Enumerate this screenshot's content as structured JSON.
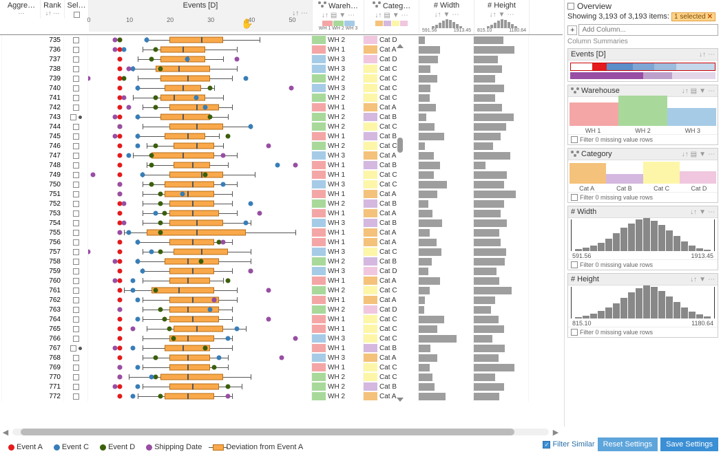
{
  "columns": {
    "aggre": "Aggre…",
    "rank": "Rank",
    "sel": "Sel…",
    "events": "Events [D]",
    "wareh": "Wareh…",
    "categ": "Categ…",
    "width": "Width",
    "height": "Height"
  },
  "axis_ticks": [
    0,
    10,
    20,
    30,
    40,
    50
  ],
  "wh_labels": [
    "WH 1",
    "WH 2",
    "WH 3"
  ],
  "cat_colors": [
    "catA",
    "catB",
    "catC",
    "catD"
  ],
  "width_range": [
    "591.56",
    "1913.45"
  ],
  "height_range": [
    "815.10",
    "1180.64"
  ],
  "legend": {
    "a": "Event A",
    "c": "Event C",
    "d": "Event D",
    "s": "Shipping Date",
    "dev": "Deviation from Event A"
  },
  "side": {
    "overview": "Overview",
    "showing": "Showing 3,193 of 3,193 items:",
    "selected": "1 selected",
    "addcol": "Add Column...",
    "cs": "Column Summaries",
    "events": "Events [D]",
    "warehouse": "Warehouse",
    "category": "Category",
    "width": "Width",
    "height": "Height",
    "filter_missing": "Filter 0 missing value rows",
    "wh_bars": [
      34,
      44,
      26
    ],
    "cat_bars": [
      30,
      14,
      32,
      18
    ],
    "cat_labels": [
      "Cat A",
      "Cat B",
      "Cat C",
      "Cat D"
    ],
    "width_hist": [
      3,
      5,
      8,
      12,
      18,
      26,
      34,
      40,
      46,
      48,
      44,
      38,
      30,
      22,
      14,
      8,
      4,
      2
    ],
    "height_hist": [
      2,
      4,
      7,
      11,
      16,
      22,
      30,
      38,
      44,
      48,
      46,
      40,
      32,
      24,
      16,
      10,
      6,
      3
    ]
  },
  "footer": {
    "filter_similar": "Filter Similar",
    "reset": "Reset Settings",
    "save": "Save Settings"
  },
  "rows": [
    {
      "rank": 735,
      "wh": 2,
      "cat": "D",
      "w": 0.12,
      "h": 0.55,
      "dA": 2,
      "dC": 13,
      "dD": 4,
      "dS": 6,
      "wl": 13,
      "wr": 38,
      "bl": 18,
      "br": 30,
      "med": 25
    },
    {
      "rank": 736,
      "wh": 1,
      "cat": "A",
      "w": 0.4,
      "h": 0.75,
      "dA": 2,
      "dC": 8,
      "dD": 12,
      "dS": 6,
      "wl": 12,
      "wr": 33,
      "bl": 16,
      "br": 26,
      "med": 21
    },
    {
      "rank": 737,
      "wh": 3,
      "cat": "D",
      "w": 0.36,
      "h": 0.45,
      "dA": 2,
      "dC": 22,
      "dD": 11,
      "dS": 33,
      "wl": 11,
      "wr": 30,
      "bl": 16,
      "br": 26,
      "med": 22
    },
    {
      "rank": 738,
      "wh": 3,
      "cat": "C",
      "w": 0.22,
      "h": 0.52,
      "dA": 2,
      "dC": 10,
      "dD": 13,
      "dS": 9,
      "wl": 10,
      "wr": 33,
      "bl": 15,
      "br": 27,
      "med": 20
    },
    {
      "rank": 739,
      "wh": 2,
      "cat": "C",
      "w": 0.34,
      "h": 0.4,
      "dA": 2,
      "dC": 35,
      "dD": 5,
      "dS": 0,
      "wl": 11,
      "wr": 32,
      "bl": 16,
      "br": 27,
      "med": 22
    },
    {
      "rank": 740,
      "wh": 3,
      "cat": "C",
      "w": 0.22,
      "h": 0.56,
      "dA": 2,
      "dC": 11,
      "dD": 24,
      "dS": 45,
      "wl": 11,
      "wr": 28,
      "bl": 17,
      "br": 25,
      "med": 21
    },
    {
      "rank": 741,
      "wh": 2,
      "cat": "C",
      "w": 0.2,
      "h": 0.4,
      "dA": 2,
      "dC": 24,
      "dD": 12,
      "dS": 8,
      "wl": 10,
      "wr": 30,
      "bl": 16,
      "br": 26,
      "med": 19
    },
    {
      "rank": 742,
      "wh": 1,
      "cat": "A",
      "w": 0.32,
      "h": 0.52,
      "dA": 2,
      "dC": 26,
      "dD": 12,
      "dS": 9,
      "wl": 12,
      "wr": 32,
      "bl": 18,
      "br": 29,
      "med": 24
    },
    {
      "rank": 743,
      "wh": 2,
      "cat": "B",
      "w": 0.14,
      "h": 0.74,
      "dA": 2,
      "dC": 11,
      "dD": 24,
      "dS": 6,
      "wl": 11,
      "wr": 31,
      "bl": 16,
      "br": 27,
      "med": 21,
      "selDot": true
    },
    {
      "rank": 744,
      "wh": 2,
      "cat": "C",
      "w": 0.3,
      "h": 0.6,
      "dA": 2,
      "dC": 36,
      "dD": 4,
      "dS": 7,
      "wl": 12,
      "wr": 36,
      "bl": 18,
      "br": 30,
      "med": 24
    },
    {
      "rank": 745,
      "wh": 1,
      "cat": "B",
      "w": 0.48,
      "h": 0.5,
      "dA": 2,
      "dC": 11,
      "dD": 28,
      "dS": 6,
      "wl": 11,
      "wr": 29,
      "bl": 17,
      "br": 26,
      "med": 22
    },
    {
      "rank": 746,
      "wh": 2,
      "cat": "C",
      "w": 0.12,
      "h": 0.36,
      "dA": 2,
      "dC": 11,
      "dD": 12,
      "dS": 40,
      "wl": 13,
      "wr": 30,
      "bl": 19,
      "br": 28,
      "med": 24
    },
    {
      "rank": 747,
      "wh": 3,
      "cat": "A",
      "w": 0.28,
      "h": 0.68,
      "dA": 2,
      "dC": 9,
      "dD": 11,
      "dS": 30,
      "wl": 10,
      "wr": 33,
      "bl": 14,
      "br": 28,
      "med": 21
    },
    {
      "rank": 748,
      "wh": 1,
      "cat": "B",
      "w": 0.4,
      "h": 0.22,
      "dA": 2,
      "dC": 42,
      "dD": 11,
      "dS": 46,
      "wl": 13,
      "wr": 31,
      "bl": 19,
      "br": 27,
      "med": 23
    },
    {
      "rank": 749,
      "wh": 1,
      "cat": "C",
      "w": 0.28,
      "h": 0.62,
      "dA": 2,
      "dC": 12,
      "dD": 23,
      "dS": 1,
      "wl": 12,
      "wr": 37,
      "bl": 18,
      "br": 30,
      "med": 25
    },
    {
      "rank": 750,
      "wh": 3,
      "cat": "C",
      "w": 0.52,
      "h": 0.56,
      "dA": 2,
      "dC": 30,
      "dD": 11,
      "dS": 7,
      "wl": 12,
      "wr": 33,
      "bl": 17,
      "br": 28,
      "med": 23
    },
    {
      "rank": 751,
      "wh": 1,
      "cat": "A",
      "w": 0.34,
      "h": 0.78,
      "dA": 2,
      "dC": 21,
      "dD": 13,
      "dS": 7,
      "wl": 12,
      "wr": 32,
      "bl": 17,
      "br": 28,
      "med": 22
    },
    {
      "rank": 752,
      "wh": 2,
      "cat": "B",
      "w": 0.18,
      "h": 0.56,
      "dA": 2,
      "dC": 36,
      "dD": 13,
      "dS": 8,
      "wl": 12,
      "wr": 32,
      "bl": 18,
      "br": 28,
      "med": 23
    },
    {
      "rank": 753,
      "wh": 1,
      "cat": "A",
      "w": 0.26,
      "h": 0.5,
      "dA": 2,
      "dC": 15,
      "dD": 14,
      "dS": 38,
      "wl": 12,
      "wr": 33,
      "bl": 18,
      "br": 29,
      "med": 23
    },
    {
      "rank": 754,
      "wh": 3,
      "cat": "B",
      "w": 0.44,
      "h": 0.62,
      "dA": 2,
      "dC": 35,
      "dD": 13,
      "dS": 8,
      "wl": 12,
      "wr": 36,
      "bl": 18,
      "br": 30,
      "med": 24
    },
    {
      "rank": 755,
      "wh": 1,
      "cat": "A",
      "w": 0.2,
      "h": 0.48,
      "dA": 2,
      "dC": 9,
      "dD": 13,
      "dS": 7,
      "wl": 8,
      "wr": 46,
      "bl": 13,
      "br": 35,
      "med": 24
    },
    {
      "rank": 756,
      "wh": 1,
      "cat": "A",
      "w": 0.33,
      "h": 0.5,
      "dA": 2,
      "dC": 11,
      "dD": 26,
      "dS": 30,
      "wl": 11,
      "wr": 32,
      "bl": 18,
      "br": 28,
      "med": 23
    },
    {
      "rank": 757,
      "wh": 3,
      "cat": "C",
      "w": 0.42,
      "h": 0.6,
      "dA": 2,
      "dC": 14,
      "dD": 13,
      "dS": 0,
      "wl": 12,
      "wr": 36,
      "bl": 19,
      "br": 31,
      "med": 25
    },
    {
      "rank": 758,
      "wh": 2,
      "cat": "B",
      "w": 0.24,
      "h": 0.58,
      "dA": 2,
      "dC": 11,
      "dD": 22,
      "dS": 6,
      "wl": 11,
      "wr": 36,
      "bl": 17,
      "br": 29,
      "med": 22
    },
    {
      "rank": 759,
      "wh": 3,
      "cat": "D",
      "w": 0.18,
      "h": 0.42,
      "dA": 2,
      "dC": 12,
      "dD": 33,
      "dS": 36,
      "wl": 12,
      "wr": 32,
      "bl": 18,
      "br": 28,
      "med": 23
    },
    {
      "rank": 760,
      "wh": 1,
      "cat": "A",
      "w": 0.4,
      "h": 0.48,
      "dA": 2,
      "dC": 10,
      "dD": 28,
      "dS": 6,
      "wl": 12,
      "wr": 30,
      "bl": 18,
      "br": 27,
      "med": 22
    },
    {
      "rank": 761,
      "wh": 2,
      "cat": "C",
      "w": 0.21,
      "h": 0.7,
      "dA": 2,
      "dC": 10,
      "dD": 12,
      "dS": 40,
      "wl": 8,
      "wr": 33,
      "bl": 14,
      "br": 28,
      "med": 20
    },
    {
      "rank": 762,
      "wh": 1,
      "cat": "A",
      "w": 0.12,
      "h": 0.4,
      "dA": 2,
      "dC": 11,
      "dD": 25,
      "dS": 28,
      "wl": 12,
      "wr": 33,
      "bl": 18,
      "br": 29,
      "med": 23
    },
    {
      "rank": 763,
      "wh": 2,
      "cat": "D",
      "w": 0.1,
      "h": 0.32,
      "dA": 2,
      "dC": 27,
      "dD": 13,
      "dS": 7,
      "wl": 12,
      "wr": 32,
      "bl": 18,
      "br": 29,
      "med": 22
    },
    {
      "rank": 764,
      "wh": 1,
      "cat": "C",
      "w": 0.48,
      "h": 0.46,
      "dA": 2,
      "dC": 11,
      "dD": 14,
      "dS": 40,
      "wl": 12,
      "wr": 32,
      "bl": 18,
      "br": 29,
      "med": 23
    },
    {
      "rank": 765,
      "wh": 1,
      "cat": "C",
      "w": 0.34,
      "h": 0.56,
      "dA": 2,
      "dC": 33,
      "dD": 15,
      "dS": 10,
      "wl": 13,
      "wr": 35,
      "bl": 19,
      "br": 30,
      "med": 24
    },
    {
      "rank": 766,
      "wh": 3,
      "cat": "C",
      "w": 0.7,
      "h": 0.34,
      "dA": 2,
      "dC": 31,
      "dD": 16,
      "dS": 46,
      "wl": 12,
      "wr": 32,
      "bl": 18,
      "br": 28,
      "med": 22
    },
    {
      "rank": 767,
      "wh": 1,
      "cat": "B",
      "w": 0.22,
      "h": 0.58,
      "dA": 2,
      "dC": 10,
      "dD": 23,
      "dS": 6,
      "wl": 12,
      "wr": 32,
      "bl": 17,
      "br": 27,
      "med": 21,
      "selDot": true
    },
    {
      "rank": 768,
      "wh": 3,
      "cat": "A",
      "w": 0.34,
      "h": 0.46,
      "dA": 2,
      "dC": 29,
      "dD": 12,
      "dS": 43,
      "wl": 12,
      "wr": 31,
      "bl": 18,
      "br": 27,
      "med": 22
    },
    {
      "rank": 769,
      "wh": 1,
      "cat": "C",
      "w": 0.2,
      "h": 0.76,
      "dA": 2,
      "dC": 11,
      "dD": 25,
      "dS": 7,
      "wl": 12,
      "wr": 31,
      "bl": 18,
      "br": 27,
      "med": 22
    },
    {
      "rank": 770,
      "wh": 2,
      "cat": "C",
      "w": 0.26,
      "h": 0.4,
      "dA": 2,
      "dC": 14,
      "dD": 12,
      "dS": 7,
      "wl": 9,
      "wr": 36,
      "bl": 16,
      "br": 30,
      "med": 22
    },
    {
      "rank": 771,
      "wh": 2,
      "cat": "B",
      "w": 0.3,
      "h": 0.56,
      "dA": 2,
      "dC": 11,
      "dD": 28,
      "dS": 6,
      "wl": 12,
      "wr": 34,
      "bl": 18,
      "br": 29,
      "med": 23
    },
    {
      "rank": 772,
      "wh": 2,
      "cat": "A",
      "w": 0.5,
      "h": 0.48,
      "dA": 2,
      "dC": 10,
      "dD": 13,
      "dS": 31,
      "wl": 11,
      "wr": 32,
      "bl": 17,
      "br": 28,
      "med": 22
    }
  ]
}
